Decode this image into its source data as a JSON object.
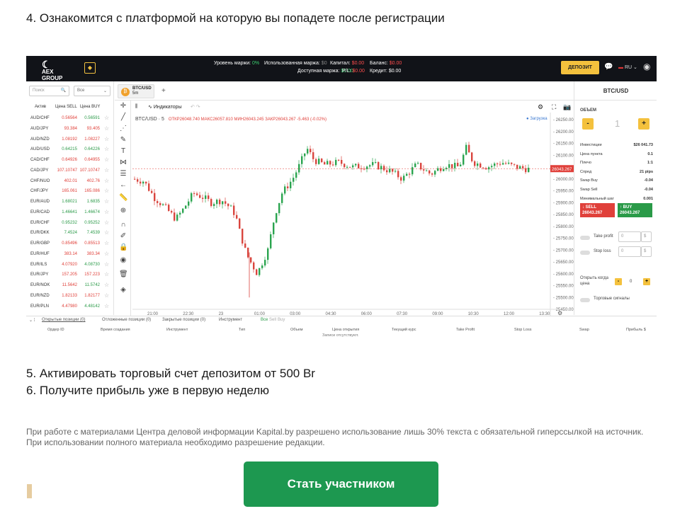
{
  "steps": {
    "step4": "4. Ознакомится с платформой на которую вы попадете после регистрации",
    "step5": "5. Активировать торговый счет депозитом от 500 Br",
    "step6": "6. Получите прибыль уже в первую неделю"
  },
  "disclaimer": "При работе с материалами Центра деловой информации Kapital.by разрешено использование лишь 30% текста с обязательной гиперссылкой на источник. При использовании полного материала необходимо разрешение редакции.",
  "cta_label": "Стать участником",
  "platform": {
    "logo_line1": "AEX",
    "logo_line2": "GROUP",
    "stats": {
      "margin_level_label": "Уровень маржи:",
      "margin_level": "0%",
      "used_margin_label": "Использованная маржа:",
      "used_margin": "$0",
      "capital_label": "Капитал:",
      "capital": "$0.00",
      "balance_label": "Баланс:",
      "balance": "$0.00",
      "free_margin_label": "Доступная маржа:",
      "free_margin": "$0.00",
      "pl_label": "P/L:",
      "pl": "$0.00",
      "credit_label": "Кредит:",
      "credit": "$0.00"
    },
    "deposit_label": "ДЕПОЗИТ",
    "lang": "RU",
    "search_placeholder": "Поиск",
    "filter_value": "Все",
    "col_asset": "Актив",
    "col_sell": "Цена SELL",
    "col_buy": "Цена BUY",
    "instruments": [
      {
        "sym": "AUD/CHF",
        "sell": "0.56564",
        "buy": "0.56591"
      },
      {
        "sym": "AUD/JPY",
        "sell": "93.384",
        "buy": "93.405"
      },
      {
        "sym": "AUD/NZD",
        "sell": "1.08192",
        "buy": "1.08227"
      },
      {
        "sym": "AUD/USD",
        "sell": "0.64215",
        "buy": "0.64226"
      },
      {
        "sym": "CAD/CHF",
        "sell": "0.64926",
        "buy": "0.64955"
      },
      {
        "sym": "CAD/JPY",
        "sell": "107.10747",
        "buy": "107.10747"
      },
      {
        "sym": "CHF/NUO",
        "sell": "402.01",
        "buy": "402.76"
      },
      {
        "sym": "CHF/JPY",
        "sell": "165.061",
        "buy": "165.086"
      },
      {
        "sym": "EUR/AUD",
        "sell": "1.68021",
        "buy": "1.6835"
      },
      {
        "sym": "EUR/CAD",
        "sell": "1.46641",
        "buy": "1.46674"
      },
      {
        "sym": "EUR/CHF",
        "sell": "0.95232",
        "buy": "0.95252"
      },
      {
        "sym": "EUR/DKK",
        "sell": "7.4524",
        "buy": "7.4539"
      },
      {
        "sym": "EUR/GBP",
        "sell": "0.85496",
        "buy": "0.85513"
      },
      {
        "sym": "EUR/HUF",
        "sell": "383.14",
        "buy": "383.34"
      },
      {
        "sym": "EUR/ILS",
        "sell": "4.07920",
        "buy": "4.08730"
      },
      {
        "sym": "EUR/JPY",
        "sell": "157.205",
        "buy": "157.223"
      },
      {
        "sym": "EUR/NOK",
        "sell": "11.5642",
        "buy": "11.5742"
      },
      {
        "sym": "EUR/NZD",
        "sell": "1.82133",
        "buy": "1.82177"
      },
      {
        "sym": "EUR/PLN",
        "sell": "4.47980",
        "buy": "4.48142"
      }
    ],
    "symbol_tab": {
      "name": "BTC/USD",
      "tf": "5m"
    },
    "indicators_label": "Индикаторы",
    "chart_symbol": "BTC/USD",
    "chart_tf": "5",
    "ohlc": "ОТКР26048.740  МАКС26057.810  МИН26043.245  ЗАКР26043.267  -5.463 (-0.02%)",
    "loading_label": "● Загрузка",
    "current_price": "26043.267",
    "y_ticks": [
      "26250.000",
      "26200.000",
      "26150.000",
      "26100.000",
      "26050.000",
      "26000.000",
      "25950.000",
      "25900.000",
      "25850.000",
      "25800.000",
      "25750.000",
      "25700.000",
      "25650.000",
      "25600.000",
      "25550.000",
      "25500.000",
      "25450.000"
    ],
    "x_ticks": [
      "21:00",
      "22:30",
      "23",
      "01:00",
      "03:00",
      "04:30",
      "06:00",
      "07:30",
      "09:00",
      "10:30",
      "12:00",
      "13:30"
    ],
    "right": {
      "title": "BTC/USD",
      "volume_label": "ОБЪЕМ",
      "volume_value": "1",
      "info": [
        {
          "k": "Инвестиции",
          "v": "$26 041.73"
        },
        {
          "k": "Цена пункта",
          "v": "0.1"
        },
        {
          "k": "Плечо",
          "v": "1:1"
        },
        {
          "k": "Спред",
          "v": "21 pips"
        },
        {
          "k": "Swap Buy",
          "v": "-0.04"
        },
        {
          "k": "Swap Sell",
          "v": "-0.04"
        },
        {
          "k": "Минимальный шаг",
          "v": "0.001"
        }
      ],
      "sell_label": "SELL",
      "sell_price": "26043.267",
      "buy_label": "BUY",
      "buy_price": "26043.267",
      "take_profit_label": "Take profit",
      "stop_loss_label": "Stop loss",
      "tp_value": "0",
      "sl_value": "0",
      "currency": "$",
      "open_when_label": "Открыть когда цена",
      "open_when_value": "0",
      "signals_label": "Торговые сигналы"
    },
    "bottom": {
      "tabs": [
        "Открытые позиции (0)",
        "Отложенные позиции (0)",
        "Закрытые позиции (0)",
        "Инструмент"
      ],
      "filters": [
        "Все",
        "Sell",
        "Buy"
      ],
      "columns": [
        "Ордер ID",
        "Время создания",
        "Инструмент",
        "Тип",
        "Объем",
        "Цена открытия",
        "Текущий курс",
        "Take Profit",
        "Stop Loss",
        "Swap",
        "Прибыль $"
      ],
      "empty_text": "Записи отсутствуют."
    }
  },
  "colors": {
    "accent_green": "#1d9850",
    "gold": "#f4c13d",
    "sell_red": "#e0403a",
    "buy_green": "#2a9a48"
  }
}
